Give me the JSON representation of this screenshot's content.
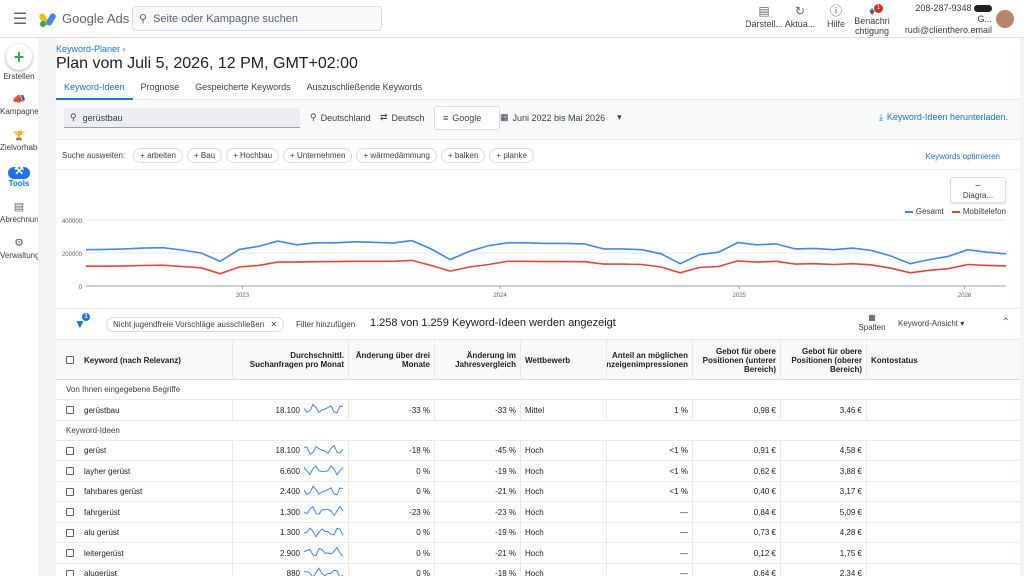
{
  "app": {
    "brand": "Google Ads"
  },
  "topbar": {
    "search_placeholder": "Seite oder Kampagne suchen",
    "actions": [
      {
        "label": "Darstell...",
        "icon": "display-icon"
      },
      {
        "label": "Aktua...",
        "icon": "refresh-icon"
      },
      {
        "label": "Hilfe",
        "icon": "help-icon"
      },
      {
        "label": "Benachrichtigung",
        "icon": "bell-icon",
        "badge": "1"
      }
    ],
    "account_id": "208-287-9348",
    "account_suffix": "G...",
    "account_email": "rudi@clienthero.email"
  },
  "rail": {
    "create_label": "Erstellen",
    "items": [
      {
        "label": "Kampagnen",
        "icon": "campaign-icon"
      },
      {
        "label": "Zielvorhaben",
        "icon": "trophy-icon"
      },
      {
        "label": "Tools",
        "icon": "tools-icon",
        "active": true
      },
      {
        "label": "Abrechnung",
        "icon": "billing-icon"
      },
      {
        "label": "Verwaltung",
        "icon": "admin-gear-icon"
      }
    ]
  },
  "header": {
    "breadcrumb": "Keyword-Planer",
    "title": "Plan vom Juli 5, 2026, 12 PM, GMT+02:00"
  },
  "tabs": [
    {
      "label": "Keyword-Ideen",
      "active": true
    },
    {
      "label": "Prognose"
    },
    {
      "label": "Gespeicherte Keywords"
    },
    {
      "label": "Auszuschließende Keywords"
    }
  ],
  "filters": {
    "keyword": "gerüstbau",
    "location": "Deutschland",
    "language": "Deutsch",
    "network": "Google",
    "date_range": "Juni 2022 bis Mai 2026",
    "download_label": "Keyword-Ideen herunterladen."
  },
  "suggest": {
    "label": "Suche ausweiten:",
    "chips": [
      "arbeiten",
      "Bau",
      "Hochbau",
      "Unternehmen",
      "wärmedämmung",
      "balken",
      "planke"
    ],
    "optimize_label": "Keywords optimieren"
  },
  "chart_data": {
    "type": "line",
    "button_label": "Diagra...",
    "x_ticks": [
      "2023",
      "2024",
      "2025",
      "2026"
    ],
    "y_ticks": [
      "400000",
      "200000",
      "0"
    ],
    "ylim": [
      0,
      400000
    ],
    "series": [
      {
        "name": "Gesamt",
        "color": "#4285f4",
        "values": [
          220000,
          222000,
          225000,
          230000,
          232000,
          218000,
          200000,
          150000,
          222000,
          240000,
          272000,
          250000,
          262000,
          262000,
          268000,
          265000,
          260000,
          275000,
          225000,
          160000,
          210000,
          245000,
          262000,
          262000,
          258000,
          258000,
          255000,
          225000,
          225000,
          220000,
          195000,
          135000,
          190000,
          205000,
          263000,
          250000,
          255000,
          225000,
          228000,
          220000,
          230000,
          215000,
          182000,
          135000,
          160000,
          180000,
          220000,
          205000,
          195000
        ]
      },
      {
        "name": "Mobiltelefon",
        "color": "#ea4335",
        "values": [
          120000,
          120000,
          122000,
          124000,
          126000,
          118000,
          110000,
          75000,
          115000,
          125000,
          145000,
          145000,
          147000,
          148000,
          150000,
          150000,
          150000,
          155000,
          125000,
          90000,
          115000,
          130000,
          150000,
          150000,
          148000,
          148000,
          147000,
          133000,
          133000,
          130000,
          115000,
          80000,
          112000,
          118000,
          152000,
          145000,
          150000,
          133000,
          135000,
          130000,
          135000,
          128000,
          108000,
          80000,
          95000,
          105000,
          130000,
          125000,
          122000
        ]
      }
    ]
  },
  "table": {
    "funnel_badge": "1",
    "filter_chip": "Nicht jugendfreie Vorschläge ausschließen",
    "add_filter": "Filter hinzufügen",
    "count_text": "1.258 von 1.259 Keyword-Ideen werden angezeigt",
    "columns_label": "Spalten",
    "view_label": "Keyword-Ansicht",
    "headers": {
      "keyword": "Keyword (nach Relevanz)",
      "volume": "Durchschnittl. Suchanfragen pro Monat",
      "change3m": "Änderung über drei Monate",
      "yoy": "Änderung im Jahresvergleich",
      "competition": "Wettbewerb",
      "share": "Anteil an möglichen Anzeigenimpressionen",
      "bid_low": "Gebot für obere Positionen (unterer Bereich)",
      "bid_high": "Gebot für obere Positionen (oberer Bereich)",
      "status": "Kontostatus"
    },
    "section_entered": "Von Ihnen eingegebene Begriffe",
    "section_ideas": "Keyword-Ideen",
    "entered": [
      {
        "keyword": "gerüstbau",
        "volume": "18.100",
        "change3m": "-33 %",
        "yoy": "-33 %",
        "competition": "Mittel",
        "share": "1 %",
        "bid_low": "0,98 €",
        "bid_high": "3,46 €"
      }
    ],
    "ideas": [
      {
        "keyword": "gerüst",
        "volume": "18.100",
        "change3m": "-18 %",
        "yoy": "-45 %",
        "competition": "Hoch",
        "share": "<1 %",
        "bid_low": "0,91 €",
        "bid_high": "4,58 €"
      },
      {
        "keyword": "layher gerüst",
        "volume": "6.600",
        "change3m": "0 %",
        "yoy": "-19 %",
        "competition": "Hoch",
        "share": "<1 %",
        "bid_low": "0,62 €",
        "bid_high": "3,88 €"
      },
      {
        "keyword": "fahrbares gerüst",
        "volume": "2.400",
        "change3m": "0 %",
        "yoy": "-21 %",
        "competition": "Hoch",
        "share": "<1 %",
        "bid_low": "0,40 €",
        "bid_high": "3,17 €"
      },
      {
        "keyword": "fahrgerüst",
        "volume": "1.300",
        "change3m": "-23 %",
        "yoy": "-23 %",
        "competition": "Hoch",
        "share": "—",
        "bid_low": "0,84 €",
        "bid_high": "5,09 €"
      },
      {
        "keyword": "alu gerüst",
        "volume": "1.300",
        "change3m": "0 %",
        "yoy": "-19 %",
        "competition": "Hoch",
        "share": "—",
        "bid_low": "0,73 €",
        "bid_high": "4,28 €"
      },
      {
        "keyword": "leitergerüst",
        "volume": "2.900",
        "change3m": "0 %",
        "yoy": "-21 %",
        "competition": "Hoch",
        "share": "—",
        "bid_low": "0,12 €",
        "bid_high": "1,75 €"
      },
      {
        "keyword": "alugerüst",
        "volume": "880",
        "change3m": "0 %",
        "yoy": "-18 %",
        "competition": "Hoch",
        "share": "—",
        "bid_low": "0,64 €",
        "bid_high": "2,34 €"
      }
    ]
  }
}
